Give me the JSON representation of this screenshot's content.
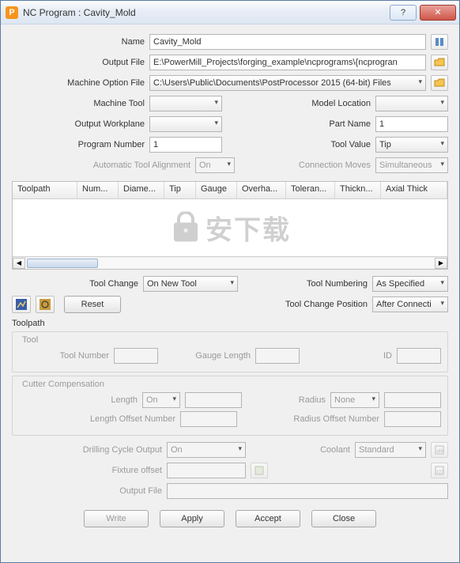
{
  "window": {
    "title": "NC Program : Cavity_Mold",
    "app_icon_letter": "P"
  },
  "fields": {
    "name": {
      "label": "Name",
      "value": "Cavity_Mold"
    },
    "output_file": {
      "label": "Output File",
      "value": "E:\\PowerMill_Projects\\forging_example\\ncprograms\\{ncprogran"
    },
    "machine_option_file": {
      "label": "Machine Option File",
      "value": "C:\\Users\\Public\\Documents\\PostProcessor 2015 (64-bit) Files"
    },
    "machine_tool": {
      "label": "Machine Tool",
      "value": ""
    },
    "model_location": {
      "label": "Model Location",
      "value": ""
    },
    "output_workplane": {
      "label": "Output Workplane",
      "value": ""
    },
    "part_name": {
      "label": "Part Name",
      "value": "1"
    },
    "program_number": {
      "label": "Program Number",
      "value": "1"
    },
    "tool_value": {
      "label": "Tool Value",
      "value": "Tip"
    },
    "auto_tool_alignment": {
      "label": "Automatic Tool Alignment",
      "value": "On"
    },
    "connection_moves": {
      "label": "Connection Moves",
      "value": "Simultaneous"
    }
  },
  "table": {
    "columns": [
      "Toolpath",
      "Num...",
      "Diame...",
      "Tip",
      "Gauge",
      "Overha...",
      "Toleran...",
      "Thickn...",
      "Axial Thick"
    ]
  },
  "middle": {
    "tool_change": {
      "label": "Tool Change",
      "value": "On New Tool"
    },
    "tool_numbering": {
      "label": "Tool Numbering",
      "value": "As Specified"
    },
    "reset": "Reset",
    "tool_change_position": {
      "label": "Tool Change Position",
      "value": "After Connecti"
    }
  },
  "toolpath": {
    "label": "Toolpath",
    "tool": {
      "legend": "Tool",
      "tool_number": "Tool Number",
      "gauge_length": "Gauge Length",
      "id": "ID"
    },
    "cutter_comp": {
      "legend": "Cutter Compensation",
      "length": {
        "label": "Length",
        "value": "On"
      },
      "radius": {
        "label": "Radius",
        "value": "None"
      },
      "length_offset": "Length Offset Number",
      "radius_offset": "Radius Offset Number"
    },
    "drilling": {
      "label": "Drilling Cycle Output",
      "value": "On"
    },
    "coolant": {
      "label": "Coolant",
      "value": "Standard"
    },
    "fixture_offset": "Fixture offset",
    "output_file": "Output File"
  },
  "buttons": {
    "write": "Write",
    "apply": "Apply",
    "accept": "Accept",
    "close": "Close"
  },
  "watermark": "安下载"
}
